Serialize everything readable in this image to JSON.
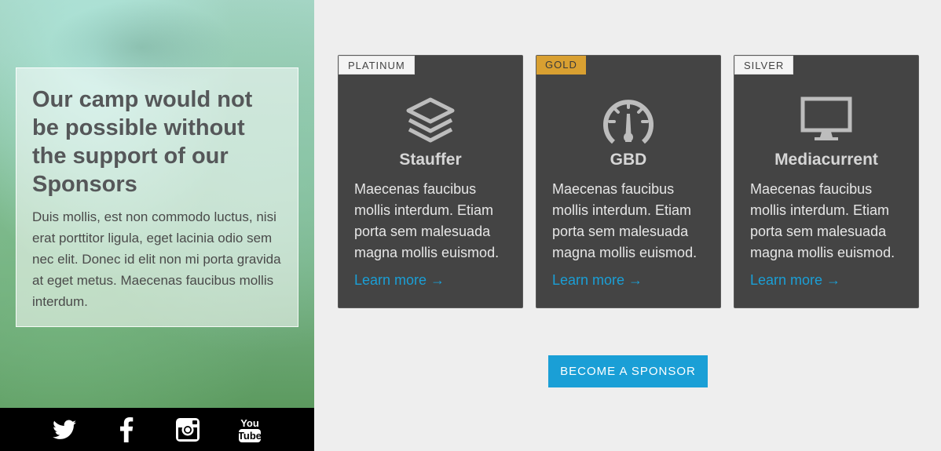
{
  "hero": {
    "title": "Our camp would not be possible without the support of our Sponsors",
    "text": "Duis mollis, est non commodo luctus, nisi erat porttitor ligula, eget lacinia odio sem nec elit. Donec id elit non mi porta gravida at eget metus. Maecenas faucibus mollis interdum."
  },
  "social": {
    "items": [
      {
        "name": "twitter-icon"
      },
      {
        "name": "facebook-icon"
      },
      {
        "name": "instagram-icon"
      },
      {
        "name": "youtube-icon",
        "label_top": "You",
        "label_bottom": "Tube"
      }
    ]
  },
  "sponsors": [
    {
      "tier": "PLATINUM",
      "icon": "layers-icon",
      "name": "Stauffer",
      "text": "Maecenas faucibus mollis interdum. Etiam porta sem malesuada magna mollis euismod.",
      "link": "Learn more →"
    },
    {
      "tier": "GOLD",
      "icon": "gauge-icon",
      "name": "GBD",
      "text": "Maecenas faucibus mollis interdum. Etiam porta sem malesuada magna mollis euismod.",
      "link": "Learn more →"
    },
    {
      "tier": "SILVER",
      "icon": "monitor-icon",
      "name": "Mediacurrent",
      "text": "Maecenas faucibus mollis interdum. Etiam porta sem malesuada magna mollis euismod.",
      "link": "Learn more →"
    }
  ],
  "cta": {
    "label": "BECOME A SPONSOR"
  },
  "colors": {
    "accent": "#1a9fd6",
    "gold": "#d9a031",
    "card": "#444444"
  }
}
